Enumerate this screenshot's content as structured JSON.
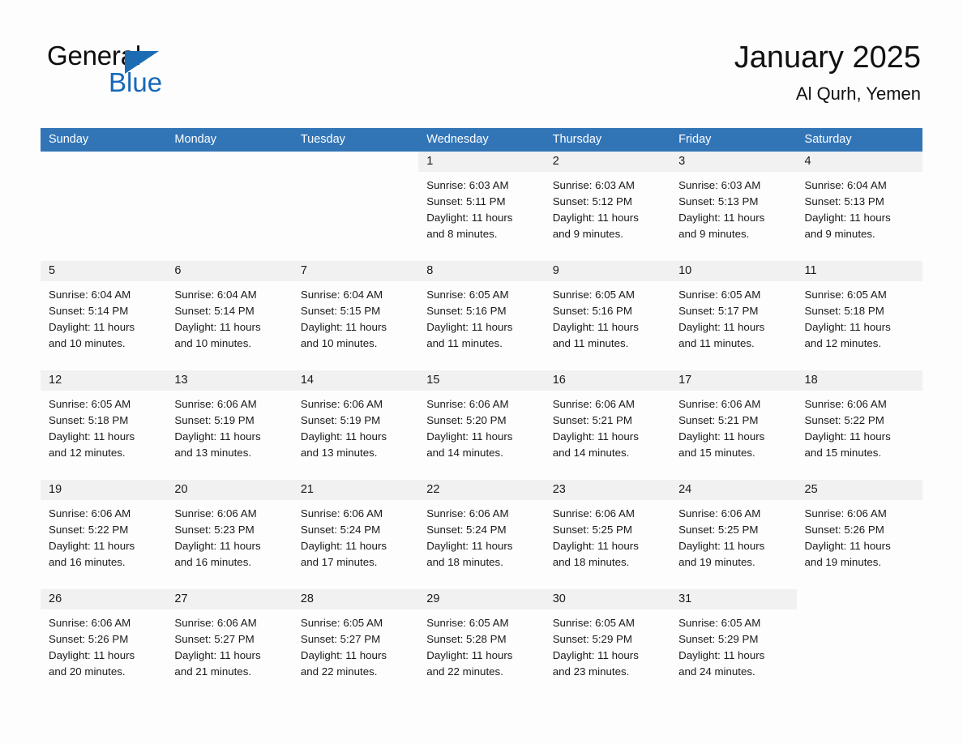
{
  "brand": {
    "name_part1": "General",
    "name_part2": "Blue",
    "accent_color": "#1668b8",
    "header_color": "#3275b7",
    "rule_color": "#2a6db0"
  },
  "header": {
    "title": "January 2025",
    "location": "Al Qurh, Yemen"
  },
  "weekdays": [
    "Sunday",
    "Monday",
    "Tuesday",
    "Wednesday",
    "Thursday",
    "Friday",
    "Saturday"
  ],
  "weeks": [
    {
      "days": [
        {
          "blank": true
        },
        {
          "blank": true
        },
        {
          "blank": true
        },
        {
          "date": "1",
          "sunrise": "Sunrise: 6:03 AM",
          "sunset": "Sunset: 5:11 PM",
          "daylight_line1": "Daylight: 11 hours",
          "daylight_line2": "and 8 minutes."
        },
        {
          "date": "2",
          "sunrise": "Sunrise: 6:03 AM",
          "sunset": "Sunset: 5:12 PM",
          "daylight_line1": "Daylight: 11 hours",
          "daylight_line2": "and 9 minutes."
        },
        {
          "date": "3",
          "sunrise": "Sunrise: 6:03 AM",
          "sunset": "Sunset: 5:13 PM",
          "daylight_line1": "Daylight: 11 hours",
          "daylight_line2": "and 9 minutes."
        },
        {
          "date": "4",
          "sunrise": "Sunrise: 6:04 AM",
          "sunset": "Sunset: 5:13 PM",
          "daylight_line1": "Daylight: 11 hours",
          "daylight_line2": "and 9 minutes."
        }
      ]
    },
    {
      "days": [
        {
          "date": "5",
          "sunrise": "Sunrise: 6:04 AM",
          "sunset": "Sunset: 5:14 PM",
          "daylight_line1": "Daylight: 11 hours",
          "daylight_line2": "and 10 minutes."
        },
        {
          "date": "6",
          "sunrise": "Sunrise: 6:04 AM",
          "sunset": "Sunset: 5:14 PM",
          "daylight_line1": "Daylight: 11 hours",
          "daylight_line2": "and 10 minutes."
        },
        {
          "date": "7",
          "sunrise": "Sunrise: 6:04 AM",
          "sunset": "Sunset: 5:15 PM",
          "daylight_line1": "Daylight: 11 hours",
          "daylight_line2": "and 10 minutes."
        },
        {
          "date": "8",
          "sunrise": "Sunrise: 6:05 AM",
          "sunset": "Sunset: 5:16 PM",
          "daylight_line1": "Daylight: 11 hours",
          "daylight_line2": "and 11 minutes."
        },
        {
          "date": "9",
          "sunrise": "Sunrise: 6:05 AM",
          "sunset": "Sunset: 5:16 PM",
          "daylight_line1": "Daylight: 11 hours",
          "daylight_line2": "and 11 minutes."
        },
        {
          "date": "10",
          "sunrise": "Sunrise: 6:05 AM",
          "sunset": "Sunset: 5:17 PM",
          "daylight_line1": "Daylight: 11 hours",
          "daylight_line2": "and 11 minutes."
        },
        {
          "date": "11",
          "sunrise": "Sunrise: 6:05 AM",
          "sunset": "Sunset: 5:18 PM",
          "daylight_line1": "Daylight: 11 hours",
          "daylight_line2": "and 12 minutes."
        }
      ]
    },
    {
      "days": [
        {
          "date": "12",
          "sunrise": "Sunrise: 6:05 AM",
          "sunset": "Sunset: 5:18 PM",
          "daylight_line1": "Daylight: 11 hours",
          "daylight_line2": "and 12 minutes."
        },
        {
          "date": "13",
          "sunrise": "Sunrise: 6:06 AM",
          "sunset": "Sunset: 5:19 PM",
          "daylight_line1": "Daylight: 11 hours",
          "daylight_line2": "and 13 minutes."
        },
        {
          "date": "14",
          "sunrise": "Sunrise: 6:06 AM",
          "sunset": "Sunset: 5:19 PM",
          "daylight_line1": "Daylight: 11 hours",
          "daylight_line2": "and 13 minutes."
        },
        {
          "date": "15",
          "sunrise": "Sunrise: 6:06 AM",
          "sunset": "Sunset: 5:20 PM",
          "daylight_line1": "Daylight: 11 hours",
          "daylight_line2": "and 14 minutes."
        },
        {
          "date": "16",
          "sunrise": "Sunrise: 6:06 AM",
          "sunset": "Sunset: 5:21 PM",
          "daylight_line1": "Daylight: 11 hours",
          "daylight_line2": "and 14 minutes."
        },
        {
          "date": "17",
          "sunrise": "Sunrise: 6:06 AM",
          "sunset": "Sunset: 5:21 PM",
          "daylight_line1": "Daylight: 11 hours",
          "daylight_line2": "and 15 minutes."
        },
        {
          "date": "18",
          "sunrise": "Sunrise: 6:06 AM",
          "sunset": "Sunset: 5:22 PM",
          "daylight_line1": "Daylight: 11 hours",
          "daylight_line2": "and 15 minutes."
        }
      ]
    },
    {
      "days": [
        {
          "date": "19",
          "sunrise": "Sunrise: 6:06 AM",
          "sunset": "Sunset: 5:22 PM",
          "daylight_line1": "Daylight: 11 hours",
          "daylight_line2": "and 16 minutes."
        },
        {
          "date": "20",
          "sunrise": "Sunrise: 6:06 AM",
          "sunset": "Sunset: 5:23 PM",
          "daylight_line1": "Daylight: 11 hours",
          "daylight_line2": "and 16 minutes."
        },
        {
          "date": "21",
          "sunrise": "Sunrise: 6:06 AM",
          "sunset": "Sunset: 5:24 PM",
          "daylight_line1": "Daylight: 11 hours",
          "daylight_line2": "and 17 minutes."
        },
        {
          "date": "22",
          "sunrise": "Sunrise: 6:06 AM",
          "sunset": "Sunset: 5:24 PM",
          "daylight_line1": "Daylight: 11 hours",
          "daylight_line2": "and 18 minutes."
        },
        {
          "date": "23",
          "sunrise": "Sunrise: 6:06 AM",
          "sunset": "Sunset: 5:25 PM",
          "daylight_line1": "Daylight: 11 hours",
          "daylight_line2": "and 18 minutes."
        },
        {
          "date": "24",
          "sunrise": "Sunrise: 6:06 AM",
          "sunset": "Sunset: 5:25 PM",
          "daylight_line1": "Daylight: 11 hours",
          "daylight_line2": "and 19 minutes."
        },
        {
          "date": "25",
          "sunrise": "Sunrise: 6:06 AM",
          "sunset": "Sunset: 5:26 PM",
          "daylight_line1": "Daylight: 11 hours",
          "daylight_line2": "and 19 minutes."
        }
      ]
    },
    {
      "days": [
        {
          "date": "26",
          "sunrise": "Sunrise: 6:06 AM",
          "sunset": "Sunset: 5:26 PM",
          "daylight_line1": "Daylight: 11 hours",
          "daylight_line2": "and 20 minutes."
        },
        {
          "date": "27",
          "sunrise": "Sunrise: 6:06 AM",
          "sunset": "Sunset: 5:27 PM",
          "daylight_line1": "Daylight: 11 hours",
          "daylight_line2": "and 21 minutes."
        },
        {
          "date": "28",
          "sunrise": "Sunrise: 6:05 AM",
          "sunset": "Sunset: 5:27 PM",
          "daylight_line1": "Daylight: 11 hours",
          "daylight_line2": "and 22 minutes."
        },
        {
          "date": "29",
          "sunrise": "Sunrise: 6:05 AM",
          "sunset": "Sunset: 5:28 PM",
          "daylight_line1": "Daylight: 11 hours",
          "daylight_line2": "and 22 minutes."
        },
        {
          "date": "30",
          "sunrise": "Sunrise: 6:05 AM",
          "sunset": "Sunset: 5:29 PM",
          "daylight_line1": "Daylight: 11 hours",
          "daylight_line2": "and 23 minutes."
        },
        {
          "date": "31",
          "sunrise": "Sunrise: 6:05 AM",
          "sunset": "Sunset: 5:29 PM",
          "daylight_line1": "Daylight: 11 hours",
          "daylight_line2": "and 24 minutes."
        },
        {
          "blank": true
        }
      ]
    }
  ]
}
